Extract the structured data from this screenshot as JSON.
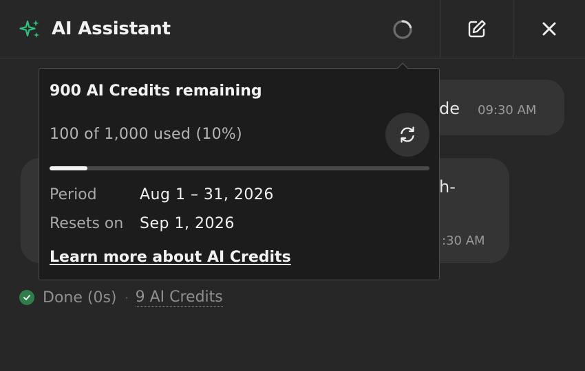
{
  "header": {
    "title": "AI Assistant",
    "logo_icon": "sparkles-icon",
    "loading_icon": "spinner-icon",
    "edit_icon": "edit-icon",
    "close_icon": "close-icon",
    "accent_color": "#2ec27e"
  },
  "chat": {
    "message1": {
      "text_fragment": "de",
      "time": "09:30 AM"
    },
    "message2": {
      "text_fragment": "h-",
      "time": ":30 AM"
    }
  },
  "status": {
    "label": "Done (0s)",
    "separator": "·",
    "credits_used": "9 AI Credits",
    "check_color": "#2f7d4b"
  },
  "popover": {
    "title": "900 AI Credits remaining",
    "usage_text": "100 of 1,000 used (10%)",
    "usage_fraction": 0.1,
    "refresh_icon": "refresh-icon",
    "period_label": "Period",
    "period_value": "Aug 1 – 31, 2026",
    "resets_label": "Resets on",
    "resets_value": "Sep 1, 2026",
    "learn_more": "Learn more about AI Credits"
  }
}
